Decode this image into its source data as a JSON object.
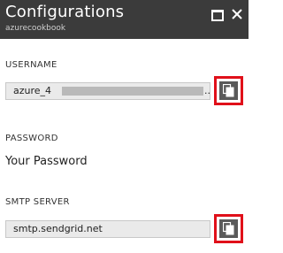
{
  "header": {
    "title": "Configurations",
    "subtitle": "azurecookbook"
  },
  "username": {
    "label": "USERNAME",
    "value": "azure_4",
    "ellipsis": ".."
  },
  "password": {
    "label": "PASSWORD",
    "value": "Your Password"
  },
  "smtp": {
    "label": "SMTP SERVER",
    "value": "smtp.sendgrid.net"
  },
  "icons": {
    "maximize": "maximize-icon",
    "close": "close-icon",
    "copy": "copy-icon"
  },
  "colors": {
    "header_bg": "#3b3b3b",
    "highlight": "#e0101a",
    "field_bg": "#eaeaea",
    "copy_button_bg": "#5a5a5a"
  }
}
